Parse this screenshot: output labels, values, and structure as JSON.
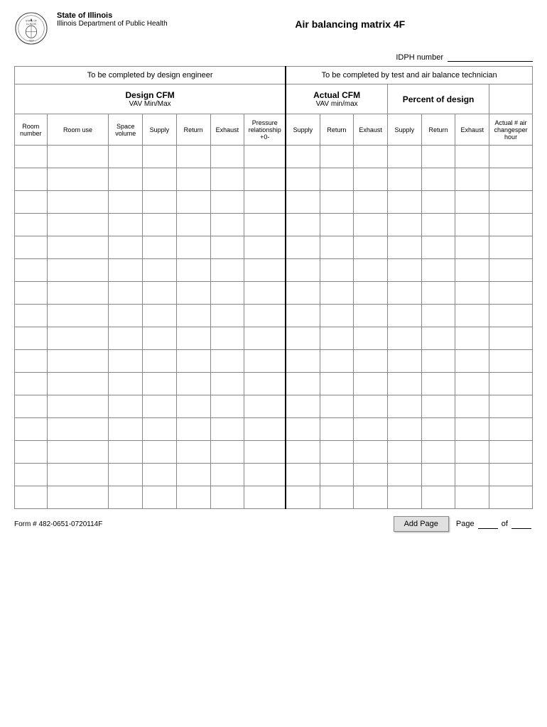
{
  "header": {
    "org_name": "State of Illinois",
    "org_sub": "Illinois Department of Public Health",
    "title": "Air balancing matrix  4F",
    "idph_label": "IDPH number"
  },
  "top_section_left": "To be completed by  design engineer",
  "top_section_right": "To be completed by test and air balance technician",
  "design_cfm_label": "Design CFM",
  "design_cfm_sub": "VAV Min/Max",
  "actual_cfm_label": "Actual CFM",
  "actual_cfm_sub": "VAV min/max",
  "percent_design_label": "Percent of design",
  "columns": {
    "left": [
      {
        "label": "Room\nnumber"
      },
      {
        "label": "Room use"
      },
      {
        "label": "Space\nvolume"
      },
      {
        "label": "Supply"
      },
      {
        "label": "Return"
      },
      {
        "label": "Exhaust"
      },
      {
        "label": "Pressure\nrelationship\n+0-"
      }
    ],
    "right": [
      {
        "label": "Supply"
      },
      {
        "label": "Return"
      },
      {
        "label": "Exhaust"
      },
      {
        "label": "Supply"
      },
      {
        "label": "Return"
      },
      {
        "label": "Exhaust"
      },
      {
        "label": "Actual # air\nchangesper\nhour"
      }
    ]
  },
  "num_data_rows": 16,
  "footer": {
    "form_number": "Form # 482-0651-0720114F",
    "add_page_label": "Add Page",
    "page_label": "Page",
    "of_label": "of"
  }
}
